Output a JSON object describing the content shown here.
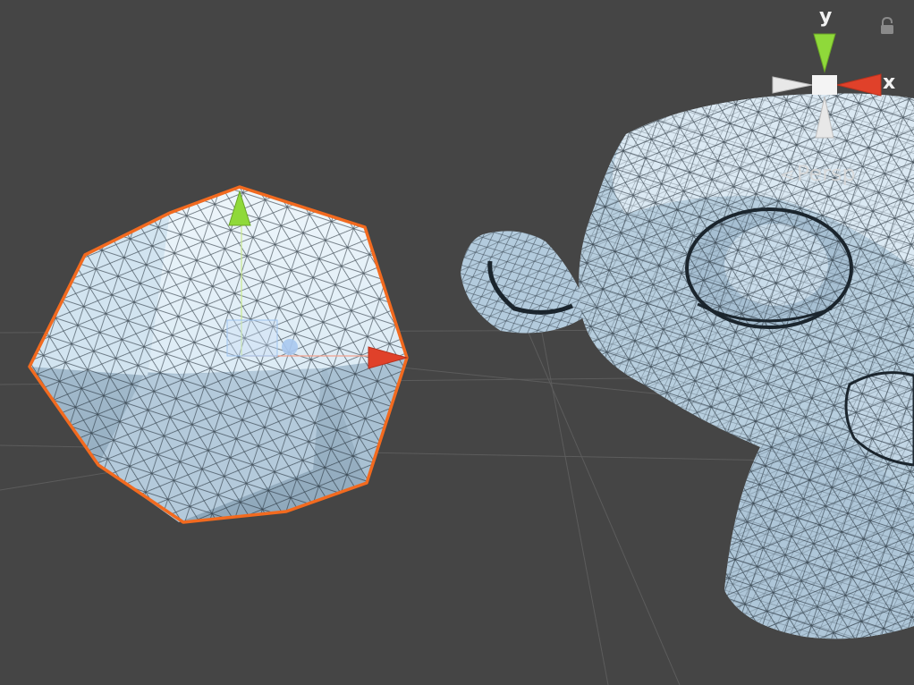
{
  "scene_view": {
    "projection_label": "Persp",
    "projection_icon": "lines-icon",
    "gizmo": {
      "y_label": "y",
      "x_label": "x",
      "colors": {
        "x": "#e0412a",
        "y": "#8fd93a",
        "z": "#3a6fd9",
        "neutral": "#f2f2f2"
      }
    },
    "lock_icon": "lock-icon",
    "objects": [
      {
        "name": "sphere-object",
        "selected": true
      },
      {
        "name": "monkey-head-object",
        "selected": false
      }
    ],
    "colors": {
      "background": "#454545",
      "selection_outline": "#f26a1f",
      "mesh_fill": "#c7dcec",
      "mesh_shade": "#9fb6c8",
      "wire": "#1e2a34"
    }
  }
}
